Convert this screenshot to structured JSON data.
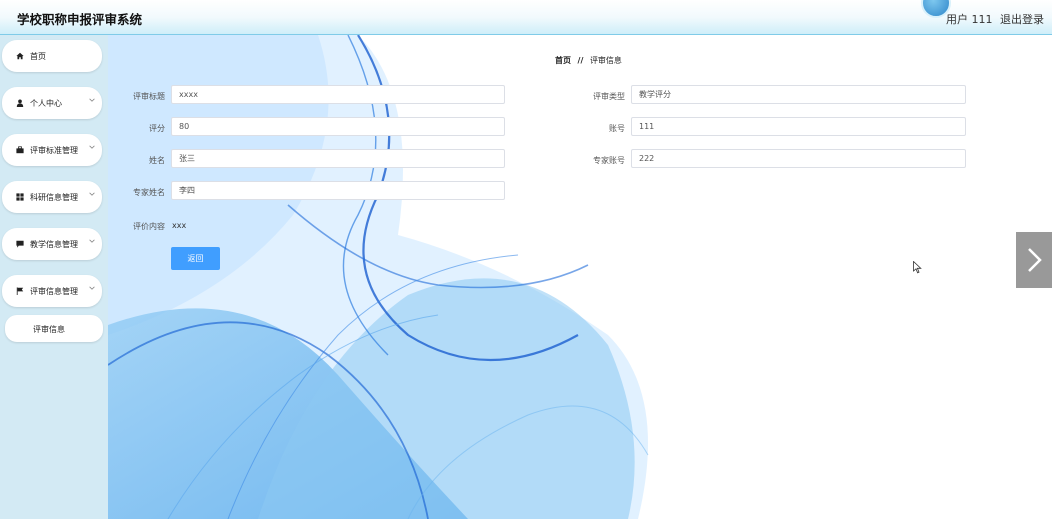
{
  "header": {
    "title": "学校职称申报评审系统",
    "user_label": "用户 111",
    "logout": "退出登录"
  },
  "sidebar": {
    "items": [
      {
        "label": "首页",
        "icon": "home-icon",
        "has_submenu": false
      },
      {
        "label": "个人中心",
        "icon": "user-icon",
        "has_submenu": true
      },
      {
        "label": "评审标准管理",
        "icon": "briefcase-icon",
        "has_submenu": true
      },
      {
        "label": "科研信息管理",
        "icon": "grid-icon",
        "has_submenu": true
      },
      {
        "label": "教学信息管理",
        "icon": "comment-icon",
        "has_submenu": true
      },
      {
        "label": "评审信息管理",
        "icon": "flag-icon",
        "has_submenu": true
      }
    ],
    "submenu": {
      "label": "评审信息"
    }
  },
  "breadcrumb": {
    "home": "首页",
    "separator": "//",
    "current": "评审信息"
  },
  "form": {
    "title_label": "评审标题",
    "title_value": "xxxx",
    "type_label": "评审类型",
    "type_value": "教学评分",
    "score_label": "评分",
    "score_value": "80",
    "account_label": "账号",
    "account_value": "111",
    "name_label": "姓名",
    "name_value": "张三",
    "expert_account_label": "专家账号",
    "expert_account_value": "222",
    "expert_name_label": "专家姓名",
    "expert_name_value": "李四",
    "content_label": "评价内容",
    "content_value": "xxx",
    "back_button": "返回"
  },
  "colors": {
    "accent": "#409eff",
    "sidebar_bg": "#d3eaf4",
    "wave_blue": "#1e7ee0"
  }
}
